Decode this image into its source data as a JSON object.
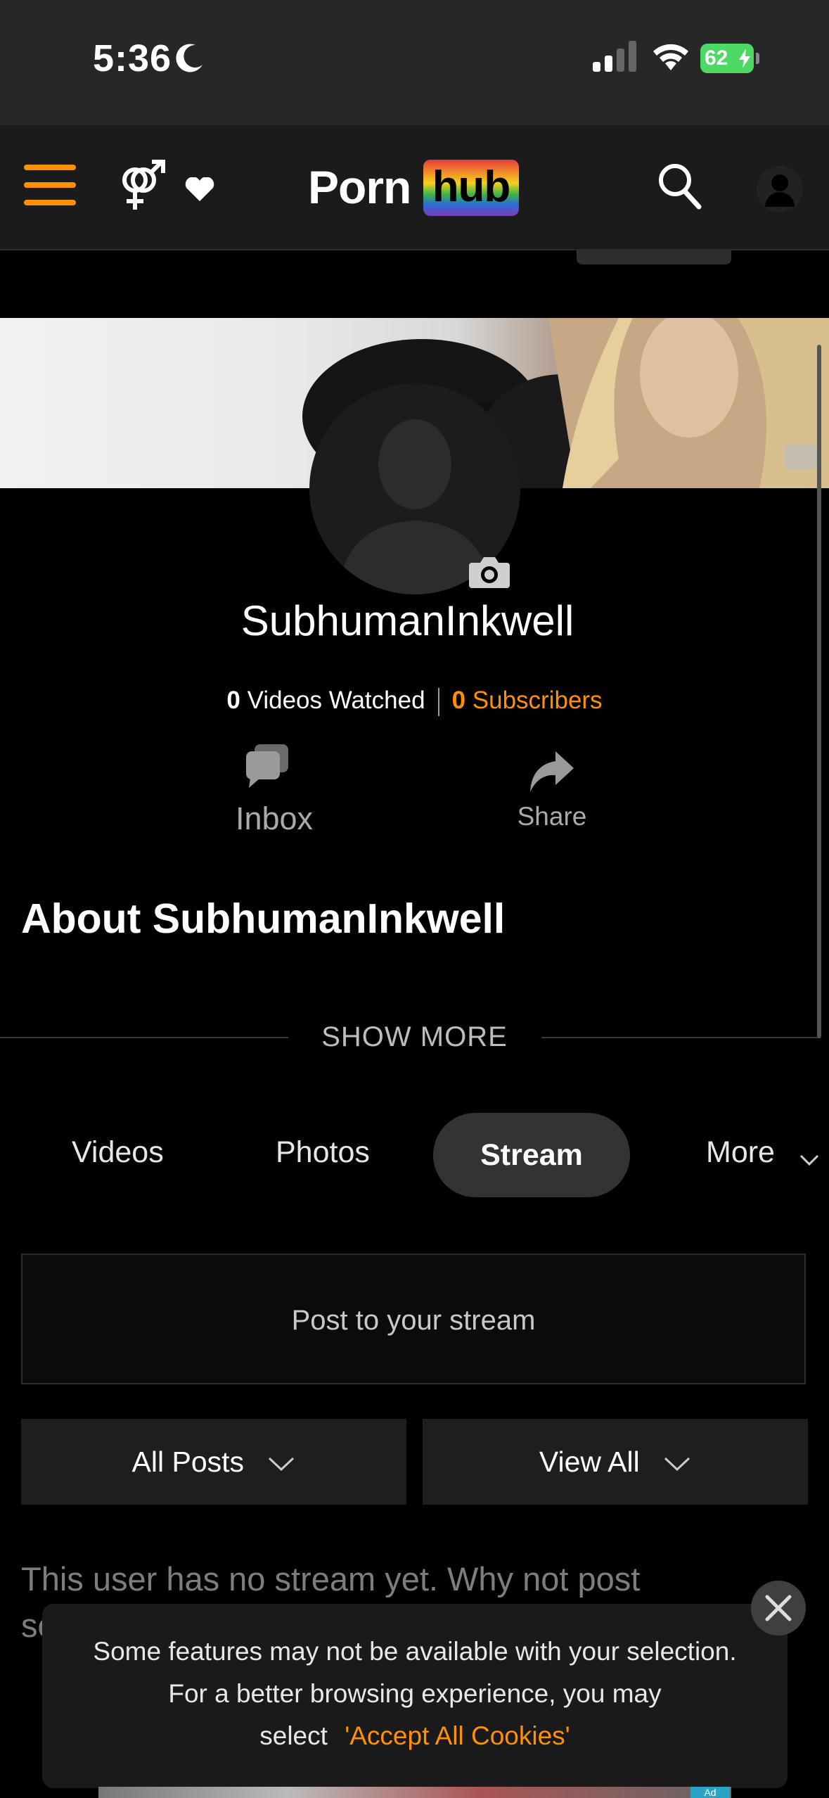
{
  "status_bar": {
    "time": "5:36",
    "battery": "62"
  },
  "header": {
    "logo_part1": "Porn",
    "logo_part2": "hub",
    "accent_color": "#ff9000"
  },
  "profile": {
    "username": "SubhumanInkwell",
    "videos_watched_count": "0",
    "videos_watched_label": "Videos Watched",
    "subscribers_count": "0",
    "subscribers_label": "Subscribers",
    "inbox_label": "Inbox",
    "share_label": "Share"
  },
  "about": {
    "heading": "About SubhumanInkwell",
    "show_more": "SHOW MORE"
  },
  "tabs": [
    {
      "label": "Videos",
      "active": false
    },
    {
      "label": "Photos",
      "active": false
    },
    {
      "label": "Stream",
      "active": true
    },
    {
      "label": "More",
      "active": false
    }
  ],
  "stream": {
    "post_placeholder": "Post to your stream",
    "filter1": "All Posts",
    "filter2": "View All",
    "empty_message": "This user has no stream yet. Why not post something!"
  },
  "cookie_notice": {
    "line1": "Some features may not be available with your selection.",
    "line2": "For a better browsing experience, you may",
    "line3_prefix": "select",
    "accept_link": "'Accept All Cookies'"
  },
  "ad": {
    "label": "Ad"
  }
}
